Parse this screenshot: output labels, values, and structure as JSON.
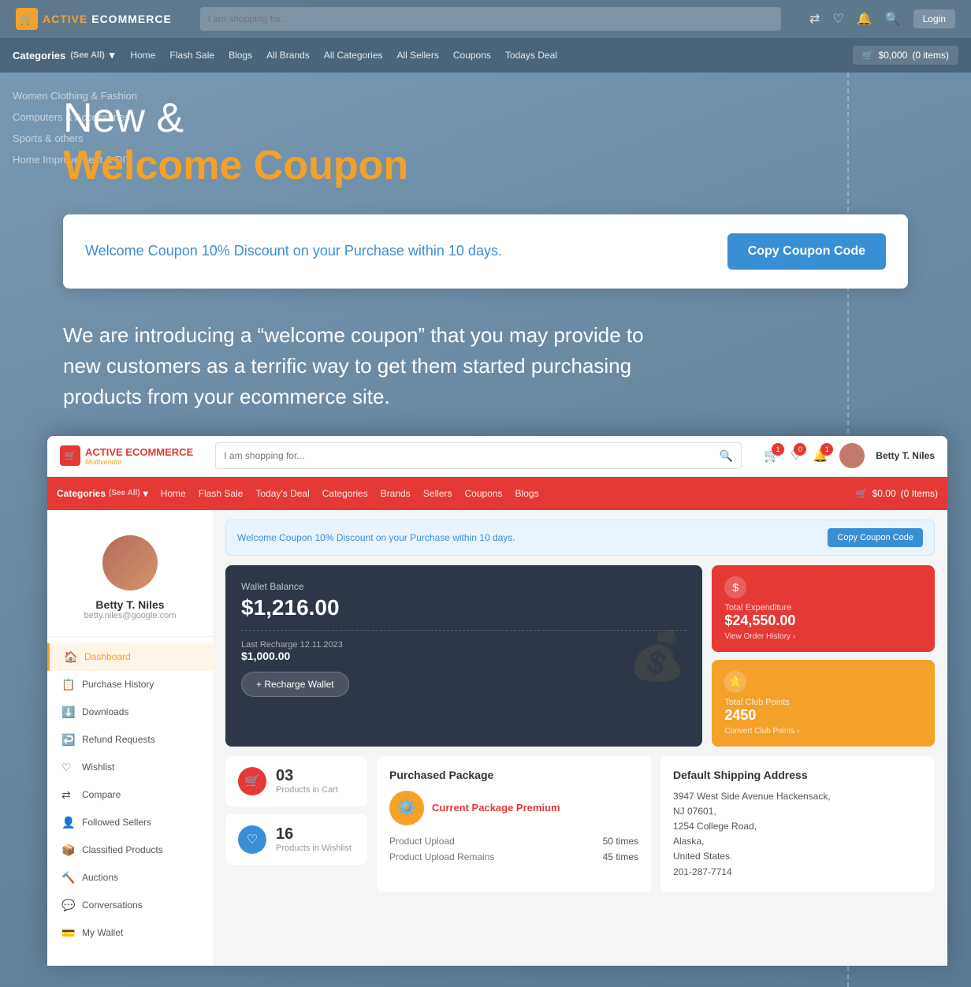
{
  "bg": {
    "categories": [
      "Women Clothing & Fashion",
      "Computers & Accessories",
      "Sports & others",
      "Home Improvement & DIY"
    ]
  },
  "topbar": {
    "logo_active": "ACTIVE",
    "logo_ecommerce": "ECOMMERCE",
    "logo_sub": "Multivendor",
    "search_placeholder": "I am shopping for...",
    "login_label": "Login"
  },
  "navbar": {
    "categories_label": "Categories",
    "categories_sub": "(See All)",
    "links": [
      "Home",
      "Flash Sale",
      "Blogs",
      "All Brands",
      "All Categories",
      "All Sellers",
      "Coupons",
      "Todays Deal"
    ],
    "cart_label": "$0,000",
    "cart_items": "(0 items)"
  },
  "hero": {
    "line1": "New &",
    "line2": "Welcome Coupon"
  },
  "coupon_banner": {
    "text": "Welcome Coupon 10% Discount on your Purchase within 10 days.",
    "button_label": "Copy Coupon Code"
  },
  "description": {
    "text": "We are introducing a “welcome coupon” that you may provide to new customers as a terrific way to get them started purchasing products from your ecommerce site."
  },
  "inner": {
    "topbar": {
      "logo_active": "ACTIVE",
      "logo_ecommerce": "ECOMMERCE",
      "logo_sub": "Multivendor",
      "search_placeholder": "I am shopping for...",
      "cart_badge": "1",
      "wishlist_badge": "0",
      "notify_badge": "1",
      "user_name": "Betty T. Niles"
    },
    "navbar": {
      "categories_label": "Categories",
      "categories_sub": "(See All)",
      "links": [
        "Home",
        "Flash Sale",
        "Today's Deal",
        "Categories",
        "Brands",
        "Sellers",
        "Coupons",
        "Blogs"
      ],
      "cart_label": "$0.00",
      "cart_items": "(0 Items)"
    },
    "sidebar": {
      "user_name": "Betty T. Niles",
      "user_email": "betty.niles@google.com",
      "menu_items": [
        {
          "label": "Dashboard",
          "icon": "🏠",
          "active": true
        },
        {
          "label": "Purchase History",
          "icon": "📋",
          "active": false
        },
        {
          "label": "Downloads",
          "icon": "⬇️",
          "active": false
        },
        {
          "label": "Refund Requests",
          "icon": "↩️",
          "active": false
        },
        {
          "label": "Wishlist",
          "icon": "♡",
          "active": false
        },
        {
          "label": "Compare",
          "icon": "⇄",
          "active": false
        },
        {
          "label": "Followed Sellers",
          "icon": "👤",
          "active": false
        },
        {
          "label": "Classified Products",
          "icon": "📦",
          "active": false
        },
        {
          "label": "Auctions",
          "icon": "🔨",
          "active": false
        },
        {
          "label": "Conversations",
          "icon": "💬",
          "active": false
        },
        {
          "label": "My Wallet",
          "icon": "💳",
          "active": false
        }
      ]
    },
    "welcome_banner": {
      "text": "Welcome Coupon 10% Discount on your Purchase within 10 days.",
      "button_label": "Copy Coupon Code"
    },
    "wallet": {
      "label": "Wallet Balance",
      "amount": "$1,216.00",
      "recharge_label": "Last Recharge",
      "recharge_date": "12.11.2023",
      "recharge_amount": "$1,000.00",
      "recharge_btn": "+ Recharge Wallet"
    },
    "total_expenditure": {
      "label": "Total Expenditure",
      "amount": "$24,550.00",
      "link": "View Order History ›"
    },
    "total_club_points": {
      "label": "Total Club Points",
      "amount": "2450",
      "link": "Convert Club Points ›"
    },
    "cart_stat": {
      "number": "03",
      "label": "Products in Cart"
    },
    "wishlist_stat": {
      "number": "16",
      "label": "Products in Wishlist"
    },
    "package": {
      "title": "Purchased Package",
      "name": "Current Package Premium",
      "product_upload": "50 times",
      "product_upload_remains": "45 times"
    },
    "address": {
      "title": "Default Shipping Address",
      "line1": "3947 West Side Avenue Hackensack,",
      "line2": "NJ 07601,",
      "line3": "1254 College Road,",
      "line4": "Alaska,",
      "line5": "United States.",
      "phone": "201-287-7714"
    }
  }
}
